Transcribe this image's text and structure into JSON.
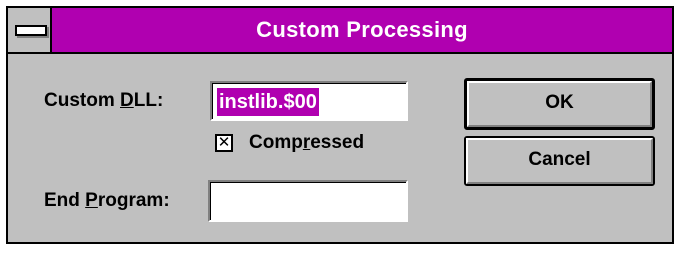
{
  "window": {
    "title": "Custom Processing"
  },
  "fields": {
    "custom_dll": {
      "label_pre": "Custom ",
      "label_accel": "D",
      "label_post": "LL:",
      "value": "instlib.$00"
    },
    "compressed": {
      "label_pre": "Comp",
      "label_accel": "r",
      "label_post": "essed",
      "checked": true,
      "mark": "✕"
    },
    "end_program": {
      "label_pre": "End ",
      "label_accel": "P",
      "label_post": "rogram:",
      "value": ""
    }
  },
  "buttons": {
    "ok_label": "OK",
    "cancel_label": "Cancel"
  },
  "colors": {
    "title_bar": "#b000b0",
    "dialog_bg": "#c0c0c0",
    "selection": "#b000b0"
  },
  "icons": {
    "system_menu": "system-menu-icon"
  }
}
